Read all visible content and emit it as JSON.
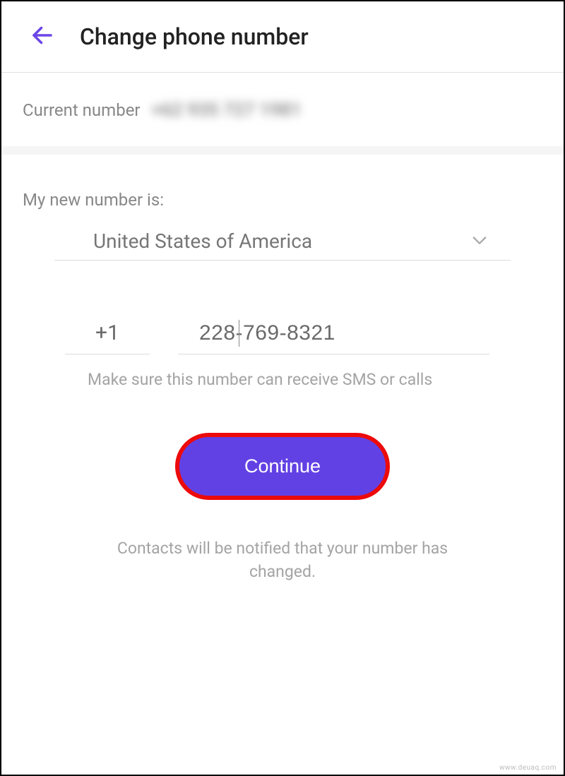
{
  "header": {
    "title": "Change phone number"
  },
  "current": {
    "label": "Current number",
    "value": "+62 935 727 1981"
  },
  "newSection": {
    "label": "My new number is:",
    "country": "United States of America",
    "dialCode": "+1",
    "phoneValue": "228-769-8321",
    "hint": "Make sure this number can receive SMS or calls"
  },
  "continueLabel": "Continue",
  "notifyText": "Contacts will be notified that your number has changed.",
  "watermark": "www.deuaq.com"
}
